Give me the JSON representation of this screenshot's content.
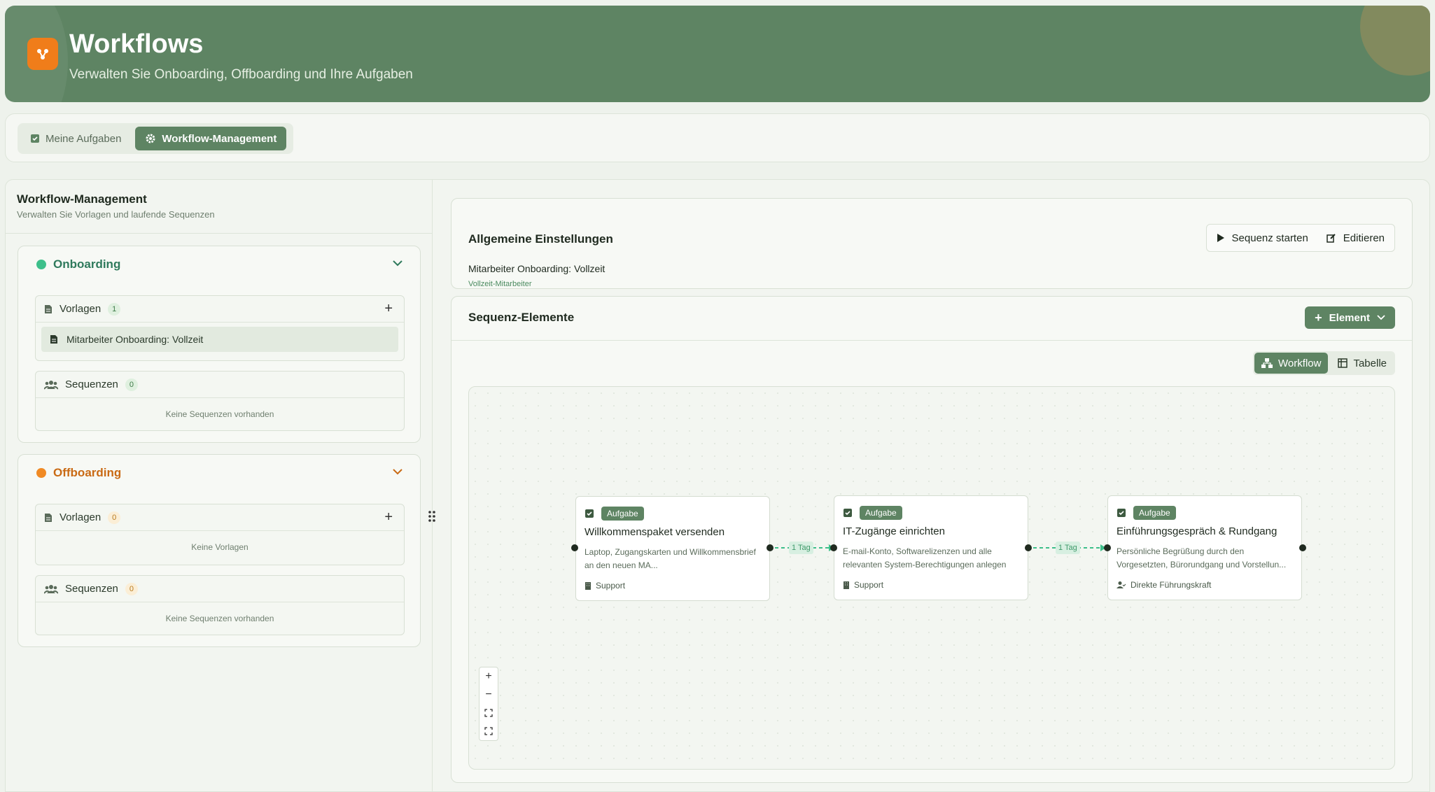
{
  "header": {
    "title": "Workflows",
    "subtitle": "Verwalten Sie Onboarding, Offboarding und Ihre Aufgaben"
  },
  "tabs": [
    {
      "label": "Meine Aufgaben"
    },
    {
      "label": "Workflow-Management"
    }
  ],
  "sidebar": {
    "title": "Workflow-Management",
    "subtitle": "Verwalten Sie Vorlagen und laufende Sequenzen",
    "onboarding": {
      "label": "Onboarding",
      "templates_label": "Vorlagen",
      "templates_count": "1",
      "template_item": "Mitarbeiter Onboarding: Vollzeit",
      "sequences_label": "Sequenzen",
      "sequences_count": "0",
      "sequences_empty": "Keine Sequenzen vorhanden"
    },
    "offboarding": {
      "label": "Offboarding",
      "templates_label": "Vorlagen",
      "templates_count": "0",
      "templates_empty": "Keine Vorlagen",
      "sequences_label": "Sequenzen",
      "sequences_count": "0",
      "sequences_empty": "Keine Sequenzen vorhanden"
    }
  },
  "settings": {
    "title": "Allgemeine Einstellungen",
    "start_label": "Sequenz starten",
    "edit_label": "Editieren",
    "name": "Mitarbeiter Onboarding: Vollzeit",
    "type": "Vollzeit-Mitarbeiter"
  },
  "sequence": {
    "title": "Sequenz-Elemente",
    "add_label": "Element",
    "view_workflow": "Workflow",
    "view_table": "Tabelle",
    "nodes": [
      {
        "tag": "Aufgabe",
        "title": "Willkommenspaket versenden",
        "desc": "Laptop, Zugangskarten und Willkommensbrief an den neuen MA...",
        "role": "Support"
      },
      {
        "tag": "Aufgabe",
        "title": "IT-Zugänge einrichten",
        "desc": "E-mail-Konto, Softwarelizenzen und alle relevanten System-Berechtigungen anlegen",
        "role": "Support"
      },
      {
        "tag": "Aufgabe",
        "title": "Einführungsgespräch & Rundgang",
        "desc": "Persönliche Begrüßung durch den Vorgesetzten, Bürorundgang und Vorstellun...",
        "role": "Direkte Führungskraft"
      }
    ],
    "edges": [
      {
        "label": "1 Tag"
      },
      {
        "label": "1 Tag"
      }
    ]
  },
  "colors": {
    "primary": "#5e8463",
    "accent": "#f07d1a",
    "onboarding": "#3dbf8a",
    "offboarding": "#f08a24"
  }
}
